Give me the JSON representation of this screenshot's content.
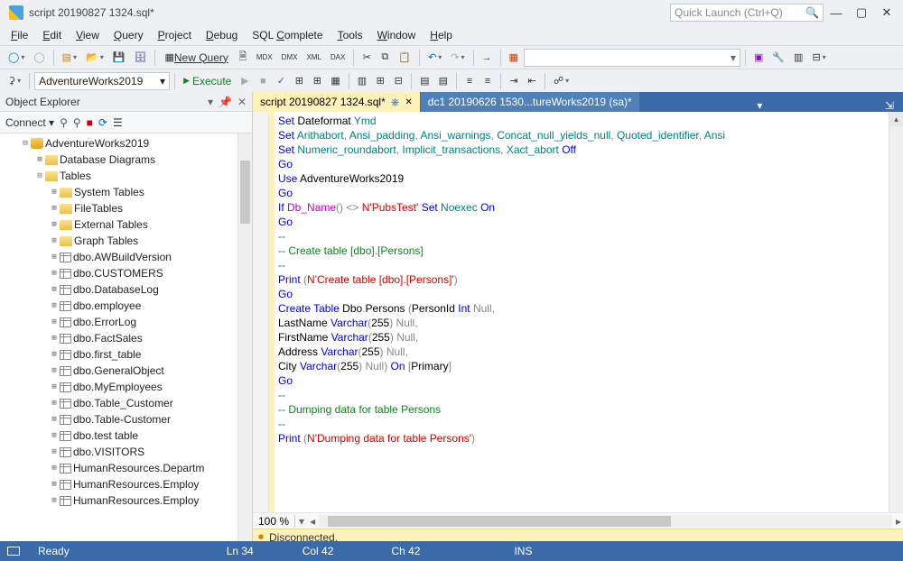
{
  "title": "script 20190827 1324.sql*",
  "quick_launch_placeholder": "Quick Launch (Ctrl+Q)",
  "menu": [
    "File",
    "Edit",
    "View",
    "Query",
    "Project",
    "Debug",
    "SQL Complete",
    "Tools",
    "Window",
    "Help"
  ],
  "toolbar2": {
    "db_combo": "AdventureWorks2019",
    "execute": "Execute",
    "new_query": "New Query"
  },
  "explorer": {
    "title": "Object Explorer",
    "connect": "Connect",
    "root": "AdventureWorks2019",
    "folders": [
      "Database Diagrams",
      "Tables"
    ],
    "subfolders": [
      "System Tables",
      "FileTables",
      "External Tables",
      "Graph Tables"
    ],
    "tables": [
      "dbo.AWBuildVersion",
      "dbo.CUSTOMERS",
      "dbo.DatabaseLog",
      "dbo.employee",
      "dbo.ErrorLog",
      "dbo.FactSales",
      "dbo.first_table",
      "dbo.GeneralObject",
      "dbo.MyEmployees",
      "dbo.Table_Customer",
      "dbo.Table-Customer",
      "dbo.test table",
      "dbo.VISITORS",
      "HumanResources.Departm",
      "HumanResources.Employ",
      "HumanResources.Employ"
    ]
  },
  "tabs": [
    {
      "label": "script 20190827 1324.sql*",
      "active": true
    },
    {
      "label": "dc1 20190626 1530...tureWorks2019 (sa)*",
      "active": false
    }
  ],
  "code_lines": [
    [
      [
        "kw",
        "Set"
      ],
      [
        "p",
        " Dateformat "
      ],
      [
        "id",
        "Ymd"
      ]
    ],
    [
      [
        "kw",
        "Set"
      ],
      [
        "p",
        " "
      ],
      [
        "id",
        "Arithabort"
      ],
      [
        "gr",
        ", "
      ],
      [
        "id",
        "Ansi_padding"
      ],
      [
        "gr",
        ", "
      ],
      [
        "id",
        "Ansi_warnings"
      ],
      [
        "gr",
        ", "
      ],
      [
        "id",
        "Concat_null_yields_null"
      ],
      [
        "gr",
        ", "
      ],
      [
        "id",
        "Quoted_identifier"
      ],
      [
        "gr",
        ", "
      ],
      [
        "id",
        "Ansi"
      ]
    ],
    [
      [
        "kw",
        "Set"
      ],
      [
        "p",
        " "
      ],
      [
        "id",
        "Numeric_roundabort"
      ],
      [
        "gr",
        ", "
      ],
      [
        "id",
        "Implicit_transactions"
      ],
      [
        "gr",
        ", "
      ],
      [
        "id",
        "Xact_abort"
      ],
      [
        "p",
        " "
      ],
      [
        "kw",
        "Off"
      ]
    ],
    [
      [
        "kw",
        "Go"
      ]
    ],
    [
      [
        "p",
        ""
      ]
    ],
    [
      [
        "kw",
        "Use"
      ],
      [
        "p",
        " AdventureWorks2019"
      ]
    ],
    [
      [
        "kw",
        "Go"
      ]
    ],
    [
      [
        "p",
        ""
      ]
    ],
    [
      [
        "kw",
        "If"
      ],
      [
        "p",
        " "
      ],
      [
        "fn",
        "Db_Name"
      ],
      [
        "gr",
        "() <> "
      ],
      [
        "str",
        "N'PubsTest'"
      ],
      [
        "p",
        " "
      ],
      [
        "kw",
        "Set"
      ],
      [
        "p",
        " "
      ],
      [
        "id",
        "Noexec"
      ],
      [
        "p",
        " "
      ],
      [
        "kw",
        "On"
      ]
    ],
    [
      [
        "kw",
        "Go"
      ]
    ],
    [
      [
        "p",
        ""
      ]
    ],
    [
      [
        "green",
        "--"
      ]
    ],
    [
      [
        "green",
        "-- Create table [dbo].[Persons]"
      ]
    ],
    [
      [
        "green",
        "--"
      ]
    ],
    [
      [
        "kw",
        "Print"
      ],
      [
        "p",
        " "
      ],
      [
        "gr",
        "("
      ],
      [
        "str",
        "N'Create table [dbo].[Persons]'"
      ],
      [
        "gr",
        ")"
      ]
    ],
    [
      [
        "kw",
        "Go"
      ]
    ],
    [
      [
        "kw",
        "Create Table"
      ],
      [
        "p",
        " Dbo"
      ],
      [
        "gr",
        "."
      ],
      [
        "p",
        "Persons "
      ],
      [
        "gr",
        "("
      ],
      [
        "p",
        "PersonId "
      ],
      [
        "kw",
        "Int"
      ],
      [
        "p",
        " "
      ],
      [
        "gr",
        "Null"
      ],
      [
        "gr",
        ","
      ]
    ],
    [
      [
        "p",
        "LastName "
      ],
      [
        "kw",
        "Varchar"
      ],
      [
        "gr",
        "("
      ],
      [
        "p",
        "255"
      ],
      [
        "gr",
        ") "
      ],
      [
        "gr",
        "Null"
      ],
      [
        "gr",
        ","
      ]
    ],
    [
      [
        "p",
        "FirstName "
      ],
      [
        "kw",
        "Varchar"
      ],
      [
        "gr",
        "("
      ],
      [
        "p",
        "255"
      ],
      [
        "gr",
        ") "
      ],
      [
        "gr",
        "Null"
      ],
      [
        "gr",
        ","
      ]
    ],
    [
      [
        "p",
        "Address "
      ],
      [
        "kw",
        "Varchar"
      ],
      [
        "gr",
        "("
      ],
      [
        "p",
        "255"
      ],
      [
        "gr",
        ") "
      ],
      [
        "gr",
        "Null"
      ],
      [
        "gr",
        ","
      ]
    ],
    [
      [
        "p",
        "City "
      ],
      [
        "kw",
        "Varchar"
      ],
      [
        "gr",
        "("
      ],
      [
        "p",
        "255"
      ],
      [
        "gr",
        ") "
      ],
      [
        "gr",
        "Null"
      ],
      [
        "gr",
        ") "
      ],
      [
        "kw",
        "On"
      ],
      [
        "p",
        " "
      ],
      [
        "gr",
        "["
      ],
      [
        "p",
        "Primary"
      ],
      [
        "gr",
        "]"
      ]
    ],
    [
      [
        "kw",
        "Go"
      ]
    ],
    [
      [
        "green",
        "--"
      ]
    ],
    [
      [
        "green",
        "-- Dumping data for table Persons"
      ]
    ],
    [
      [
        "green",
        "--"
      ]
    ],
    [
      [
        "kw",
        "Print"
      ],
      [
        "p",
        " "
      ],
      [
        "gr",
        "("
      ],
      [
        "str",
        "N'Dumping data for table Persons'"
      ],
      [
        "gr",
        ")"
      ]
    ]
  ],
  "zoom": "100 %",
  "disconnected": "Disconnected.",
  "status": {
    "ready": "Ready",
    "ln": "Ln 34",
    "col": "Col 42",
    "ch": "Ch 42",
    "ins": "INS"
  },
  "chart_data": null
}
